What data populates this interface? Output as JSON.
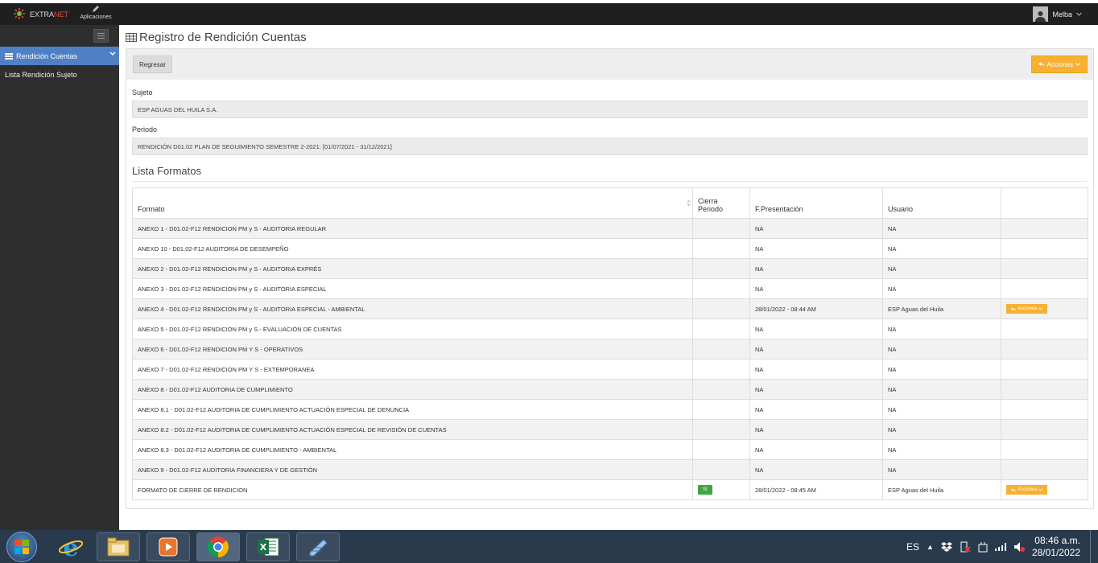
{
  "topbar": {
    "brand_pre": "EXTRA",
    "brand_post": "NET",
    "apps_label": "Aplicaciones",
    "user_name": "Melba"
  },
  "sidebar": {
    "active_item": "Rendición Cuentas",
    "sub_item": "Lista Rendición Sujeto"
  },
  "page": {
    "title": "Registro de Rendición Cuentas"
  },
  "toolbar": {
    "back_label": "Regresar",
    "actions_label": "Acciones"
  },
  "form": {
    "sujeto_label": "Sujeto",
    "sujeto_value": "ESP AGUAS DEL HUILA S.A.",
    "periodo_label": "Periodo",
    "periodo_value": "RENDICIÓN D01.02 PLAN DE SEGUIMIENTO SEMESTRE 2-2021: [01/07/2021 - 31/12/2021]"
  },
  "section_title": "Lista Formatos",
  "table": {
    "headers": {
      "formato": "Formato",
      "cierra_1": "Cierra",
      "cierra_2": "Periodo",
      "fpresentacion": "F.Presentación",
      "usuario": "Usuario"
    },
    "row_action_label": "Acciones",
    "rows": [
      {
        "formato": "ANEXO 1 - D01.02-F12 RENDICION PM y S - AUDITORIA REGULAR",
        "cierra": "",
        "fecha": "NA",
        "usuario": "NA",
        "accion": false
      },
      {
        "formato": "ANEXO 10 - D01.02-F12 AUDITORIA DE DESEMPEÑO",
        "cierra": "",
        "fecha": "NA",
        "usuario": "NA",
        "accion": false
      },
      {
        "formato": "ANEXO 2 - D01.02-F12 RENDICION PM y S - AUDITORIA EXPRÉS",
        "cierra": "",
        "fecha": "NA",
        "usuario": "NA",
        "accion": false
      },
      {
        "formato": "ANEXO 3 - D01.02-F12 RENDICION PM y S - AUDITORIA ESPECIAL",
        "cierra": "",
        "fecha": "NA",
        "usuario": "NA",
        "accion": false
      },
      {
        "formato": "ANEXO 4 - D01.02-F12 RENDICION PM y S - AUDITORIA ESPECIAL - AMBIENTAL",
        "cierra": "",
        "fecha": "28/01/2022 - 08:44 AM",
        "usuario": "ESP Aguas del Huila",
        "accion": true
      },
      {
        "formato": "ANEXO 5 - D01.02-F12 RENDICION PM y S - EVALUACIÓN DE CUENTAS",
        "cierra": "",
        "fecha": "NA",
        "usuario": "NA",
        "accion": false
      },
      {
        "formato": "ANEXO 6 - D01.02-F12 RENDICION PM Y S - OPERATIVOS",
        "cierra": "",
        "fecha": "NA",
        "usuario": "NA",
        "accion": false
      },
      {
        "formato": "ANEXO 7 - D01.02-F12 RENDICION PM Y S - EXTEMPORANEA",
        "cierra": "",
        "fecha": "NA",
        "usuario": "NA",
        "accion": false
      },
      {
        "formato": "ANEXO 8 - D01.02-F12 AUDITORIA DE CUMPLIMIENTO",
        "cierra": "",
        "fecha": "NA",
        "usuario": "NA",
        "accion": false
      },
      {
        "formato": "ANEXO 8.1 - D01.02-F12 AUDITORIA DE CUMPLIMIENTO ACTUACIÓN ESPECIAL DE DENUNCIA",
        "cierra": "",
        "fecha": "NA",
        "usuario": "NA",
        "accion": false
      },
      {
        "formato": "ANEXO 8.2 - D01.02-F12 AUDITORIA DE CUMPLIMIENTO ACTUACIÓN ESPECIAL DE REVISIÓN DE CUENTAS",
        "cierra": "",
        "fecha": "NA",
        "usuario": "NA",
        "accion": false
      },
      {
        "formato": "ANEXO 8.3 - D01.02-F12 AUDITORIA DE CUMPLIMIENTO - AMBIENTAL",
        "cierra": "",
        "fecha": "NA",
        "usuario": "NA",
        "accion": false
      },
      {
        "formato": "ANEXO 9 - D01.02-F12 AUDITORIA FINANCIERA Y DE GESTIÓN",
        "cierra": "",
        "fecha": "NA",
        "usuario": "NA",
        "accion": false
      },
      {
        "formato": "FORMATO DE CIERRE DE RENDICION",
        "cierra": "SI",
        "fecha": "28/01/2022 - 08:45 AM",
        "usuario": "ESP Aguas del Huila",
        "accion": true
      }
    ]
  },
  "taskbar": {
    "lang": "ES",
    "time": "08:46 a.m.",
    "date": "28/01/2022"
  },
  "colors": {
    "accent_blue": "#4f80c6",
    "action_orange": "#f6b133",
    "badge_green": "#3ea63e"
  }
}
